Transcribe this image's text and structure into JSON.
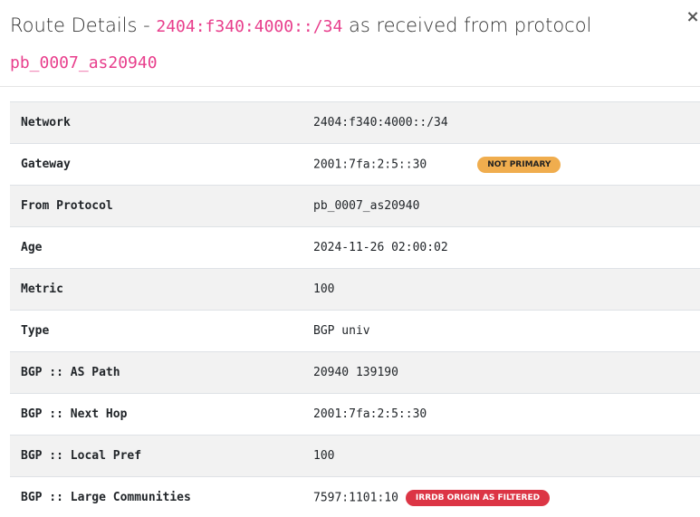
{
  "modal": {
    "title_prefix": "Route Details - ",
    "network_code": "2404:f340:4000::/34",
    "title_middle": " as received from protocol",
    "protocol_code": "pb_0007_as20940",
    "close_label": "×"
  },
  "colors": {
    "code_accent": "#e83e8c",
    "warning_badge": "#f0ad4e",
    "danger_badge": "#dc3545"
  },
  "details": [
    {
      "key": "Network",
      "value": "2404:f340:4000::/34"
    },
    {
      "key": "Gateway",
      "value": "2001:7fa:2:5::30",
      "badge": "NOT PRIMARY"
    },
    {
      "key": "From Protocol",
      "value": "pb_0007_as20940"
    },
    {
      "key": "Age",
      "value": "2024-11-26 02:00:02"
    },
    {
      "key": "Metric",
      "value": "100"
    },
    {
      "key": "Type",
      "value": "BGP univ"
    },
    {
      "key": "BGP :: AS Path",
      "value": "20940 139190"
    },
    {
      "key": "BGP :: Next Hop",
      "value": "2001:7fa:2:5::30"
    },
    {
      "key": "BGP :: Local Pref",
      "value": "100"
    },
    {
      "key": "BGP :: Large Communities",
      "value": "7597:1101:10",
      "badge": "IRRDB ORIGIN AS FILTERED"
    }
  ]
}
